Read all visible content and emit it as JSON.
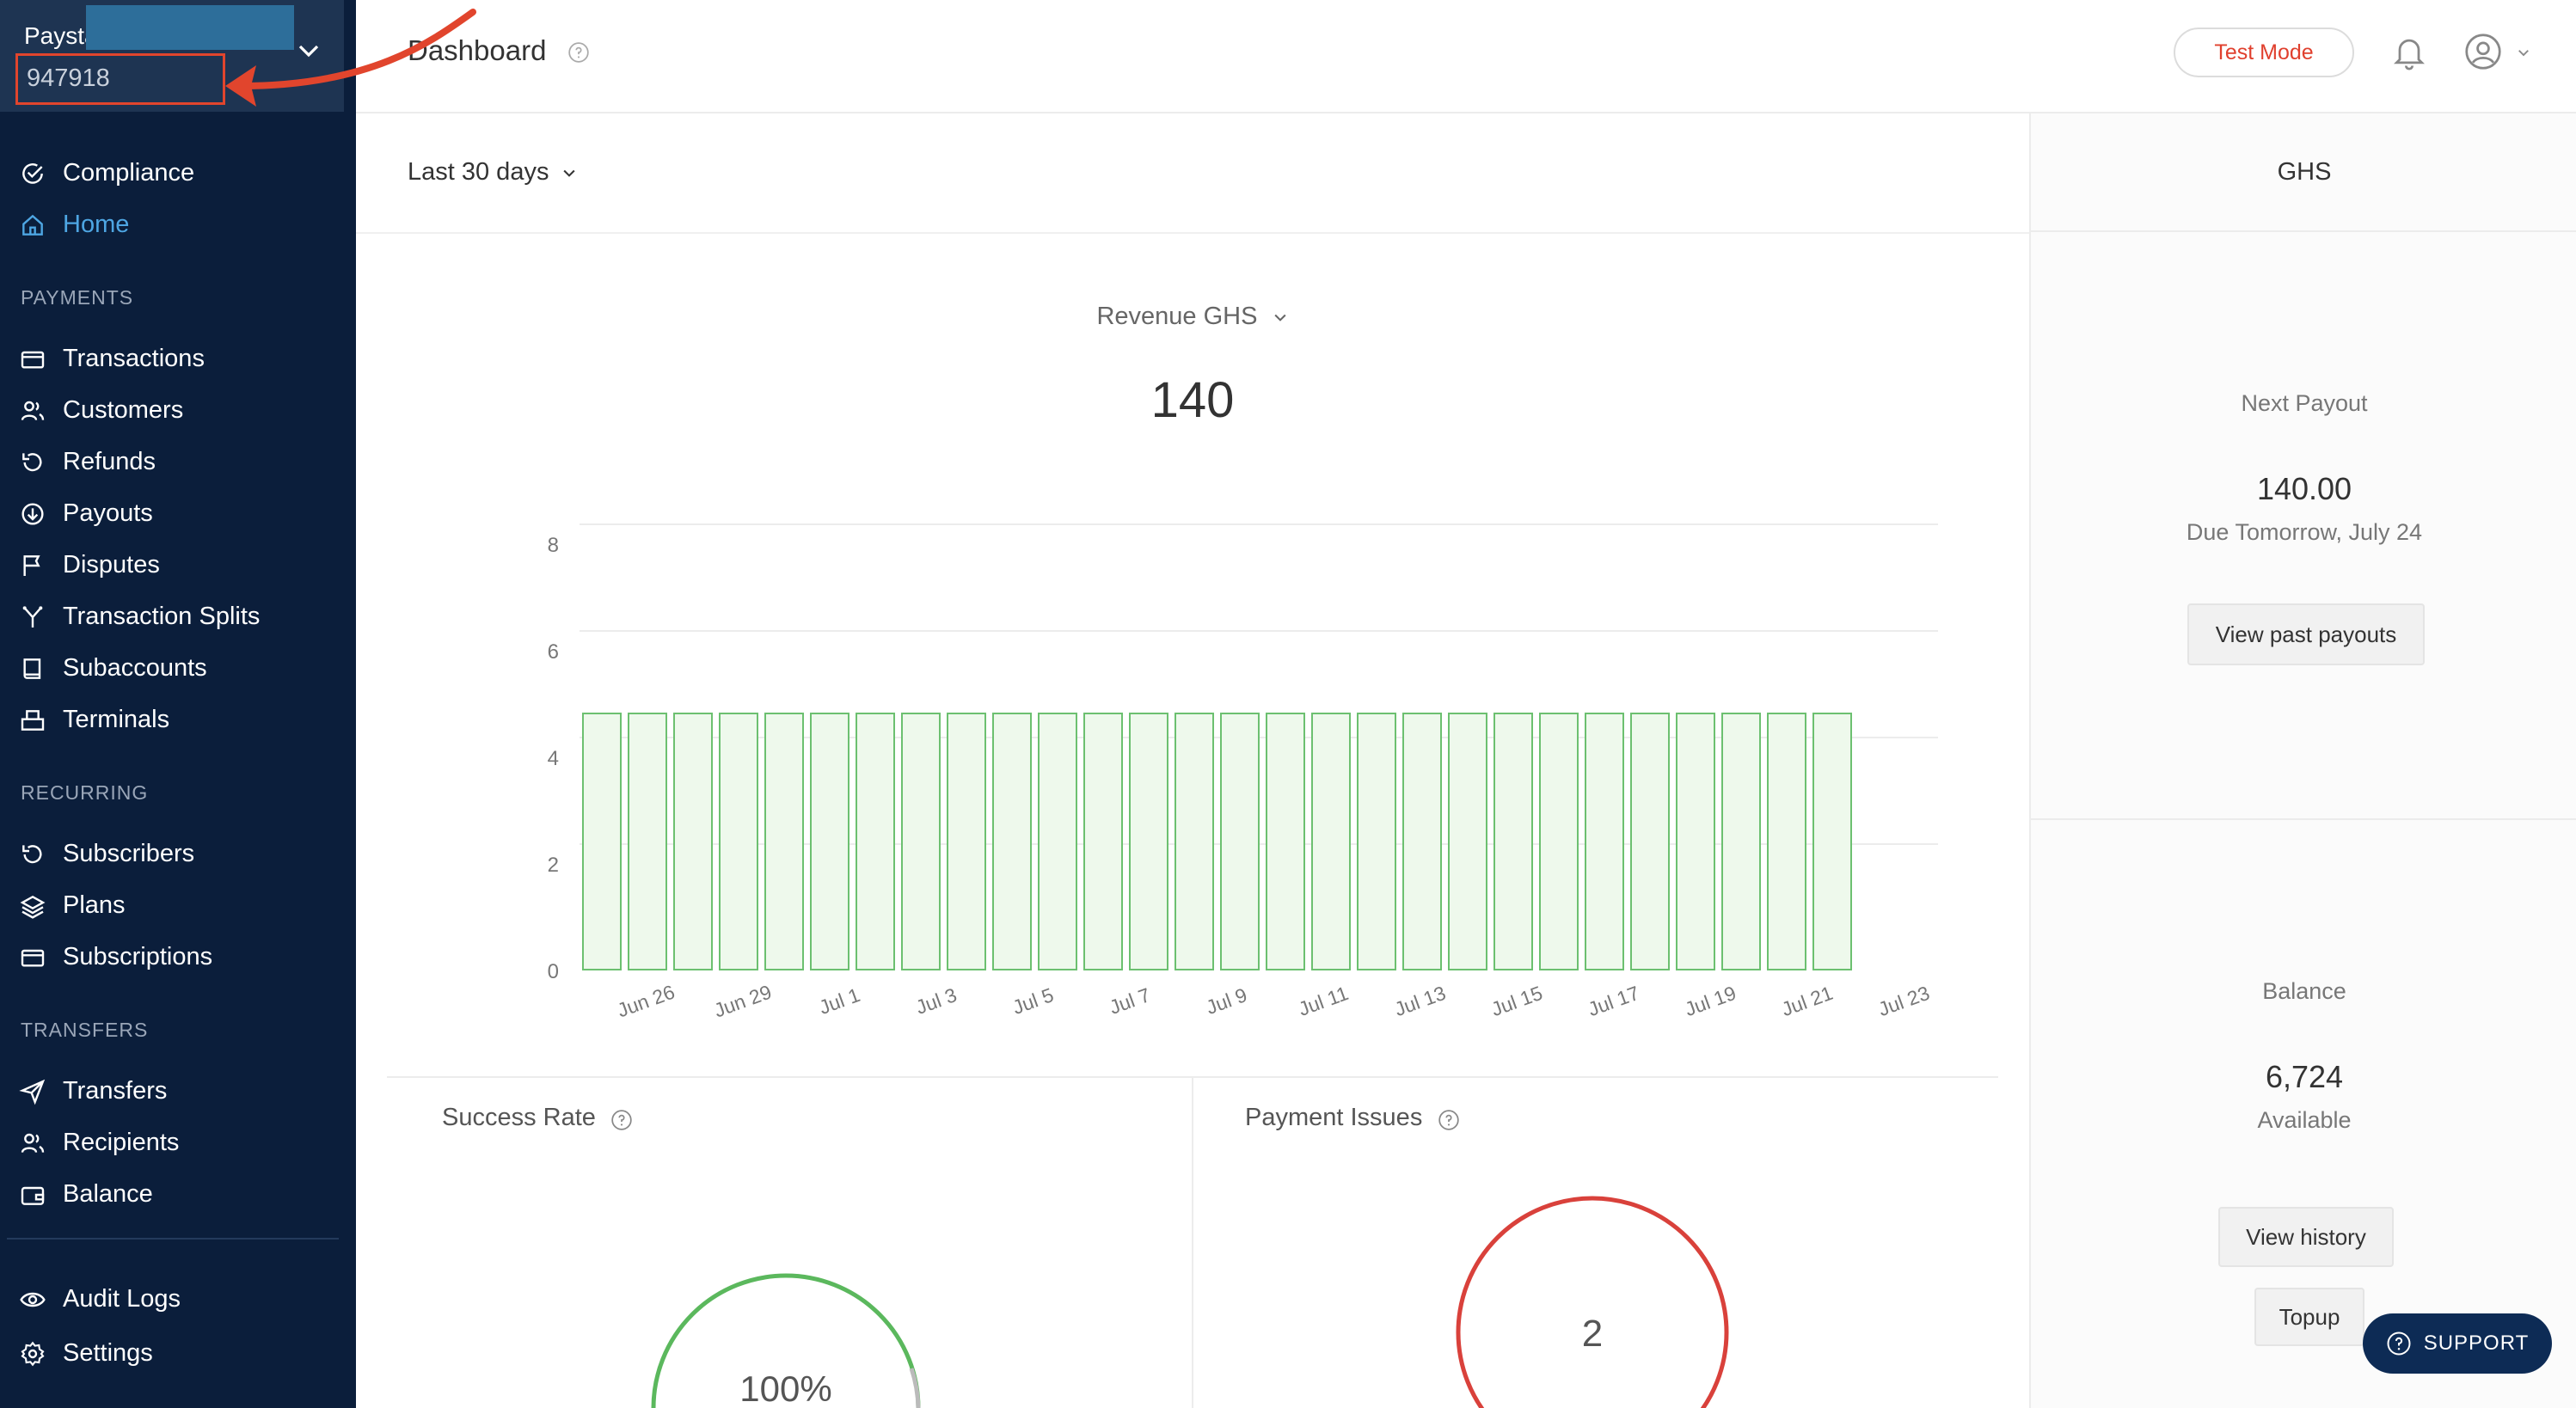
{
  "sidebar": {
    "business_name": "Paysta",
    "business_id": "947918",
    "top_items": [
      {
        "label": "Compliance",
        "icon": "check-circle-icon"
      },
      {
        "label": "Home",
        "icon": "home-icon",
        "active": true
      }
    ],
    "sections": [
      {
        "title": "PAYMENTS",
        "items": [
          {
            "label": "Transactions",
            "icon": "card-icon"
          },
          {
            "label": "Customers",
            "icon": "users-icon"
          },
          {
            "label": "Refunds",
            "icon": "refund-icon"
          },
          {
            "label": "Payouts",
            "icon": "download-circle-icon"
          },
          {
            "label": "Disputes",
            "icon": "flag-icon"
          },
          {
            "label": "Transaction Splits",
            "icon": "split-icon"
          },
          {
            "label": "Subaccounts",
            "icon": "book-icon"
          },
          {
            "label": "Terminals",
            "icon": "terminal-icon"
          }
        ]
      },
      {
        "title": "RECURRING",
        "items": [
          {
            "label": "Subscribers",
            "icon": "refund-icon"
          },
          {
            "label": "Plans",
            "icon": "layers-icon"
          },
          {
            "label": "Subscriptions",
            "icon": "card-icon"
          }
        ]
      },
      {
        "title": "TRANSFERS",
        "items": [
          {
            "label": "Transfers",
            "icon": "send-icon"
          },
          {
            "label": "Recipients",
            "icon": "users-icon"
          },
          {
            "label": "Balance",
            "icon": "wallet-icon"
          }
        ]
      }
    ],
    "bottom_items": [
      {
        "label": "Audit Logs",
        "icon": "eye-icon"
      },
      {
        "label": "Settings",
        "icon": "gear-icon"
      }
    ]
  },
  "header": {
    "title": "Dashboard",
    "test_mode_label": "Test Mode"
  },
  "main": {
    "date_range": "Last 30 days",
    "metric_label": "Revenue GHS",
    "metric_value": "140",
    "success_rate_title": "Success Rate",
    "success_rate_value": "100%",
    "payment_issues_title": "Payment Issues",
    "payment_issues_value": "2"
  },
  "chart_data": {
    "type": "bar",
    "x_tick_labels": [
      "Jun 26",
      "Jun 29",
      "Jul 1",
      "Jul 3",
      "Jul 5",
      "Jul 7",
      "Jul 9",
      "Jul 11",
      "Jul 13",
      "Jul 15",
      "Jul 17",
      "Jul 19",
      "Jul 21",
      "Jul 23"
    ],
    "y_ticks": [
      0,
      2,
      4,
      6,
      8
    ],
    "ylim": [
      0,
      8
    ],
    "values": [
      5,
      5,
      5,
      5,
      5,
      5,
      5,
      5,
      5,
      5,
      5,
      5,
      5,
      5,
      5,
      5,
      5,
      5,
      5,
      5,
      5,
      5,
      5,
      5,
      5,
      5,
      5,
      5
    ],
    "bar_color": "#eef9ec",
    "bar_stroke": "#6cc070",
    "grid": true
  },
  "right_panel": {
    "currency": "GHS",
    "next_payout_label": "Next Payout",
    "next_payout_amount": "140.00",
    "next_payout_due": "Due Tomorrow, July 24",
    "view_past_payouts": "View past payouts",
    "balance_label": "Balance",
    "balance_amount": "6,724",
    "balance_sub": "Available",
    "view_history": "View history",
    "topup": "Topup"
  },
  "support_label": "SUPPORT",
  "colors": {
    "sidebar_bg": "#0b1e3b",
    "active": "#4ea6e3",
    "success": "#5bb85d",
    "danger": "#d9413b",
    "annotation": "#e1452d"
  }
}
